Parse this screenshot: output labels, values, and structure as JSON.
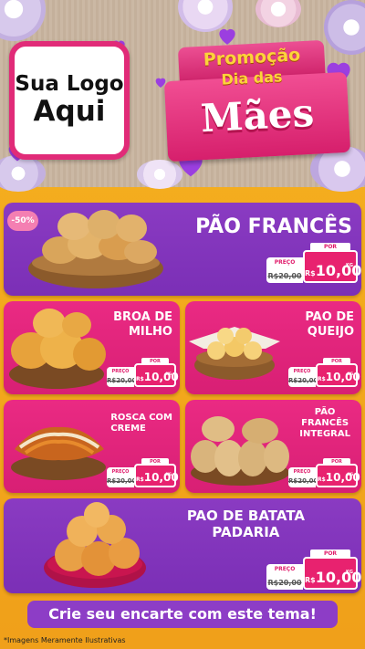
{
  "header": {
    "logo_line1": "Sua Logo",
    "logo_line2": "Aqui",
    "promo_line1": "Promoção",
    "promo_line2": "Dia das",
    "promo_line3": "Mães"
  },
  "colors": {
    "purple": "#7b2fb6",
    "pink": "#d81f74",
    "yellow_bg": "#f0a01a",
    "promo_yellow": "#fcd33a"
  },
  "discount_badge": "-50%",
  "products": [
    {
      "name": "PÃO FRANCÊS",
      "old_label": "PREÇO",
      "old_price": "R$20,00",
      "por": "POR",
      "currency": "R$",
      "price": "10,00",
      "unit": "KG"
    },
    {
      "name_l1": "BROA DE",
      "name_l2": "MILHO",
      "old_label": "PREÇO",
      "old_price": "R$20,00",
      "por": "POR",
      "currency": "R$",
      "price": "10,00",
      "unit": "KG"
    },
    {
      "name_l1": "PAO DE",
      "name_l2": "QUEIJO",
      "old_label": "PREÇO",
      "old_price": "R$20,00",
      "por": "POR",
      "currency": "R$",
      "price": "10,00",
      "unit": "KG"
    },
    {
      "name_l1": "ROSCA COM",
      "name_l2": "CREME",
      "old_label": "PREÇO",
      "old_price": "R$20,00",
      "por": "POR",
      "currency": "R$",
      "price": "10,00",
      "unit": "KG"
    },
    {
      "name_l1": "PÃO",
      "name_l2": "FRANCÊS",
      "name_l3": "INTEGRAL",
      "old_label": "PREÇO",
      "old_price": "R$20,00",
      "por": "POR",
      "currency": "R$",
      "price": "10,00",
      "unit": "KG"
    },
    {
      "name_l1": "PAO DE BATATA",
      "name_l2": "PADARIA",
      "old_label": "PREÇO",
      "old_price": "R$20,00",
      "por": "POR",
      "currency": "R$",
      "price": "10,00",
      "unit": "KG"
    }
  ],
  "cta": "Crie seu encarte com este tema!",
  "disclaimer": "*Imagens Meramente Ilustrativas"
}
